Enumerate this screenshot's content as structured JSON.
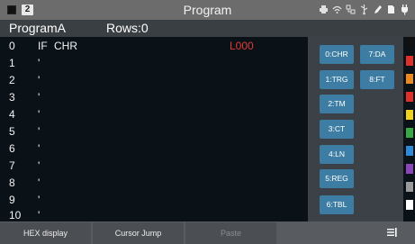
{
  "statusbar": {
    "channel": "2",
    "title": "Program",
    "icons": [
      "printer-icon",
      "wifi-icon",
      "network-icon",
      "usb-icon",
      "pen-icon",
      "storage-icon",
      "power-plug-icon"
    ]
  },
  "header": {
    "program_name": "ProgramA",
    "rows": "Rows:0"
  },
  "code_lines": [
    {
      "n": "0",
      "cmd": "IF",
      "arg": "CHR",
      "label": "L000"
    },
    {
      "n": "1",
      "cmd": "'"
    },
    {
      "n": "2",
      "cmd": "'"
    },
    {
      "n": "3",
      "cmd": "'"
    },
    {
      "n": "4",
      "cmd": "'"
    },
    {
      "n": "5",
      "cmd": "'"
    },
    {
      "n": "6",
      "cmd": "'"
    },
    {
      "n": "7",
      "cmd": "'"
    },
    {
      "n": "8",
      "cmd": "'"
    },
    {
      "n": "9",
      "cmd": "'"
    },
    {
      "n": "10",
      "cmd": "'"
    }
  ],
  "panel": {
    "left": [
      "0:CHR",
      "1:TRG",
      "2:TM",
      "3:CT",
      "4:LN",
      "5:REG",
      "6:TBL"
    ],
    "right": [
      "7:DA",
      "8:FT"
    ]
  },
  "color_swatches": [
    "#111111",
    "#e0302a",
    "#e98a1e",
    "#e0302a",
    "#f0d21e",
    "#37a843",
    "#2c8ad8",
    "#8a45b6",
    "#9a9a9a",
    "#ffffff"
  ],
  "toolbar": {
    "hex_display": "HEX display",
    "cursor_jump": "Cursor Jump",
    "paste": "Paste"
  }
}
